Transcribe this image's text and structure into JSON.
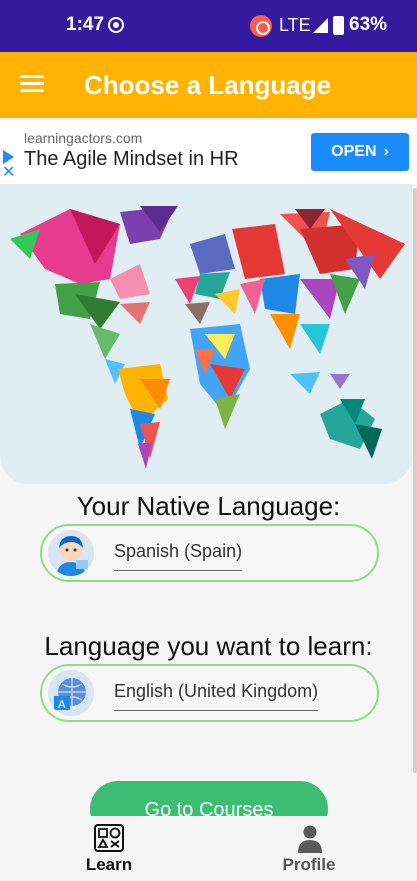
{
  "status_bar": {
    "time": "1:47",
    "network": "LTE",
    "battery": "63%"
  },
  "app_bar": {
    "title": "Choose a Language",
    "menu_icon": "hamburger-menu-icon"
  },
  "ad": {
    "domain": "learningactors.com",
    "headline": "The Agile Mindset in HR",
    "cta_label": "OPEN",
    "cta_icon": "chevron-right-icon"
  },
  "hero_image": "world-map-tangram-illustration",
  "native_language": {
    "label": "Your Native Language:",
    "value": "Spanish (Spain)",
    "icon": "person-avatar-icon"
  },
  "target_language": {
    "label": "Language you want to learn:",
    "value": "English (United Kingdom)",
    "icon": "globe-translate-icon"
  },
  "primary_button": {
    "label": "Go to Courses"
  },
  "bottom_nav": {
    "tabs": [
      {
        "label": "Learn",
        "icon": "shapes-icon",
        "active": true
      },
      {
        "label": "Profile",
        "icon": "person-icon",
        "active": false
      }
    ]
  },
  "colors": {
    "status_bar": "#331a9e",
    "app_bar": "#ffb300",
    "ad_button": "#1a8cff",
    "select_border": "#8fdc86",
    "primary_button": "#3dbd73"
  }
}
